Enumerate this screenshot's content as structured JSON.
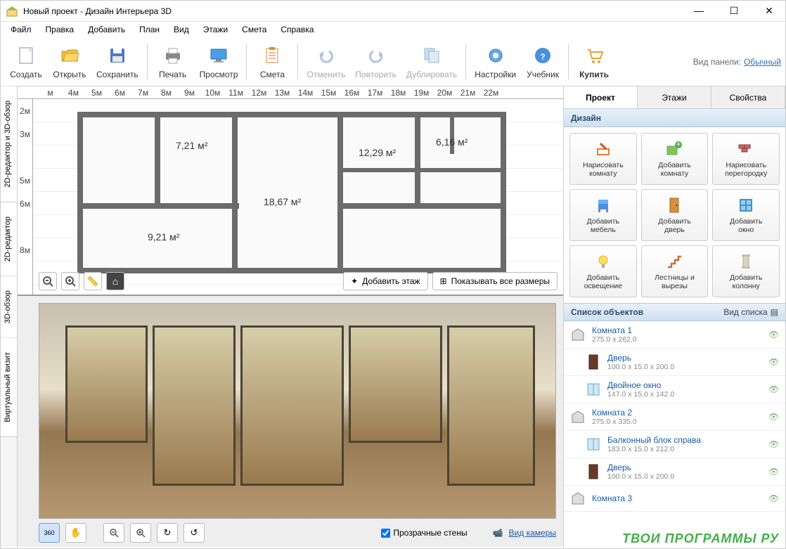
{
  "window": {
    "title": "Новый проект - Дизайн Интерьера 3D"
  },
  "menu": [
    "Файл",
    "Правка",
    "Добавить",
    "План",
    "Вид",
    "Этажи",
    "Смета",
    "Справка"
  ],
  "toolbar": {
    "create": "Создать",
    "open": "Открыть",
    "save": "Сохранить",
    "print": "Печать",
    "preview": "Просмотр",
    "estimate": "Смета",
    "undo": "Отменить",
    "redo": "Повторить",
    "duplicate": "Дублировать",
    "settings": "Настройки",
    "tutorial": "Учебник",
    "buy": "Купить",
    "panel_mode_label": "Вид панели:",
    "panel_mode_value": "Обычный"
  },
  "sidetabs": {
    "combo": "2D-редактор и 3D-обзор",
    "editor2d": "2D-редактор",
    "view3d": "3D-обзор",
    "virtual": "Виртуальный визит"
  },
  "ruler_h": [
    "м",
    "4м",
    "5м",
    "6м",
    "7м",
    "8м",
    "9м",
    "10м",
    "11м",
    "12м",
    "13м",
    "14м",
    "15м",
    "16м",
    "17м",
    "18м",
    "19м",
    "20м",
    "21м",
    "22м"
  ],
  "ruler_v": [
    "2м",
    "3м",
    "",
    "5м",
    "6м",
    "",
    "8м"
  ],
  "rooms": {
    "r1": "7,21 м²",
    "r2": "12,29 м²",
    "r3": "6,16 м²",
    "r4": "18,67 м²",
    "r5": "9,21 м²"
  },
  "plan_actions": {
    "add_floor": "Добавить этаж",
    "show_dims": "Показывать все размеры"
  },
  "view3d_controls": {
    "transparent": "Прозрачные стены",
    "camera": "Вид камеры"
  },
  "rp_tabs": {
    "project": "Проект",
    "floors": "Этажи",
    "props": "Свойства"
  },
  "rp_section": "Дизайн",
  "rp_buttons": [
    {
      "label": "Нарисовать\nкомнату",
      "icon": "draw-room"
    },
    {
      "label": "Добавить\nкомнату",
      "icon": "add-room"
    },
    {
      "label": "Нарисовать\nперегородку",
      "icon": "draw-wall"
    },
    {
      "label": "Добавить\nмебель",
      "icon": "add-furniture"
    },
    {
      "label": "Добавить\nдверь",
      "icon": "add-door"
    },
    {
      "label": "Добавить\nокно",
      "icon": "add-window"
    },
    {
      "label": "Добавить\nосвещение",
      "icon": "add-light"
    },
    {
      "label": "Лестницы и\nвырезы",
      "icon": "stairs"
    },
    {
      "label": "Добавить\nколонну",
      "icon": "add-column"
    }
  ],
  "object_list_header": "Список объектов",
  "list_mode_label": "Вид списка",
  "objects": [
    {
      "name": "Комната 1",
      "dim": "275.0 x 262.0",
      "icon": "room",
      "child": false
    },
    {
      "name": "Дверь",
      "dim": "100.0 x 15.0 x 200.0",
      "icon": "door",
      "child": true
    },
    {
      "name": "Двойное окно",
      "dim": "147.0 x 15.0 x 142.0",
      "icon": "window",
      "child": true
    },
    {
      "name": "Комната 2",
      "dim": "275.0 x 335.0",
      "icon": "room",
      "child": false
    },
    {
      "name": "Балконный блок справа",
      "dim": "183.0 x 15.0 x 212.0",
      "icon": "window",
      "child": true
    },
    {
      "name": "Дверь",
      "dim": "100.0 x 15.0 x 200.0",
      "icon": "door",
      "child": true
    },
    {
      "name": "Комната 3",
      "dim": "",
      "icon": "room",
      "child": false
    }
  ],
  "watermark": "ТВОИ ПРОГРАММЫ РУ"
}
